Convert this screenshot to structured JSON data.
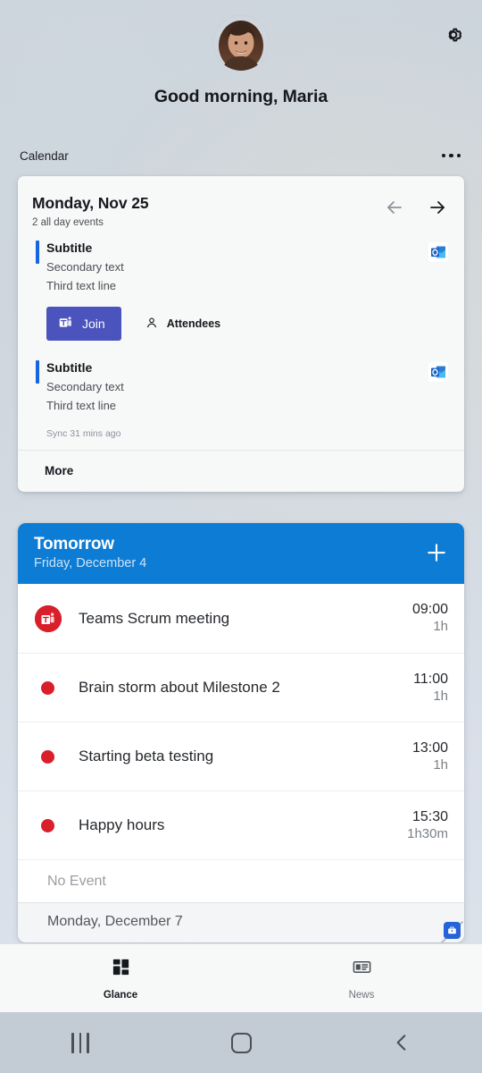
{
  "statusbar": {},
  "header": {
    "avatar_name": "user-avatar",
    "greeting": "Good morning, Maria",
    "settings_icon": "gear-icon"
  },
  "section": {
    "label": "Calendar",
    "overflow_icon": "more-horizontal-icon"
  },
  "calendar_card": {
    "date": "Monday, Nov 25",
    "subtitle": "2 all day events",
    "prev_icon": "arrow-left-icon",
    "next_icon": "arrow-right-icon",
    "events": [
      {
        "title": "Subtitle",
        "secondary": "Secondary text",
        "third": "Third text line",
        "app_icon": "outlook-icon",
        "accent": "#1565e0",
        "has_actions": true
      },
      {
        "title": "Subtitle",
        "secondary": "Secondary text",
        "third": "Third text line",
        "app_icon": "outlook-icon",
        "accent": "#1565e0",
        "has_actions": false
      }
    ],
    "join_label": "Join",
    "join_icon": "teams-icon",
    "attendees_label": "Attendees",
    "attendees_icon": "person-icon",
    "sync_text": "Sync 31 mins ago",
    "more_label": "More"
  },
  "tomorrow_card": {
    "title": "Tomorrow",
    "subtitle": "Friday, December 4",
    "add_icon": "plus-icon",
    "header_color": "#0c7cd5",
    "rows": [
      {
        "icon": "teams-round-icon",
        "name": "Teams Scrum meeting",
        "time": "09:00",
        "duration": "1h"
      },
      {
        "icon": "dot-icon",
        "name": "Brain storm about Milestone 2",
        "time": "11:00",
        "duration": "1h"
      },
      {
        "icon": "dot-icon",
        "name": "Starting beta testing",
        "time": "13:00",
        "duration": "1h"
      },
      {
        "icon": "dot-icon",
        "name": "Happy hours",
        "time": "15:30",
        "duration": "1h30m"
      }
    ],
    "no_event_label": "No Event",
    "next_day_label": "Monday, December 7",
    "work_badge_icon": "briefcase-icon",
    "resize_handle": "resize-handle"
  },
  "tabbar": {
    "tabs": [
      {
        "label": "Glance",
        "icon": "glance-grid-icon",
        "active": true
      },
      {
        "label": "News",
        "icon": "news-icon",
        "active": false
      }
    ]
  },
  "navbar": {
    "recents_icon": "recents-icon",
    "home_icon": "home-icon",
    "back_icon": "back-icon"
  },
  "colors": {
    "accent_blue": "#0c7cd5",
    "event_accent": "#1565e0",
    "teams_purple": "#4b53bc",
    "event_red": "#d81f2a",
    "work_badge_blue": "#2563d8"
  }
}
